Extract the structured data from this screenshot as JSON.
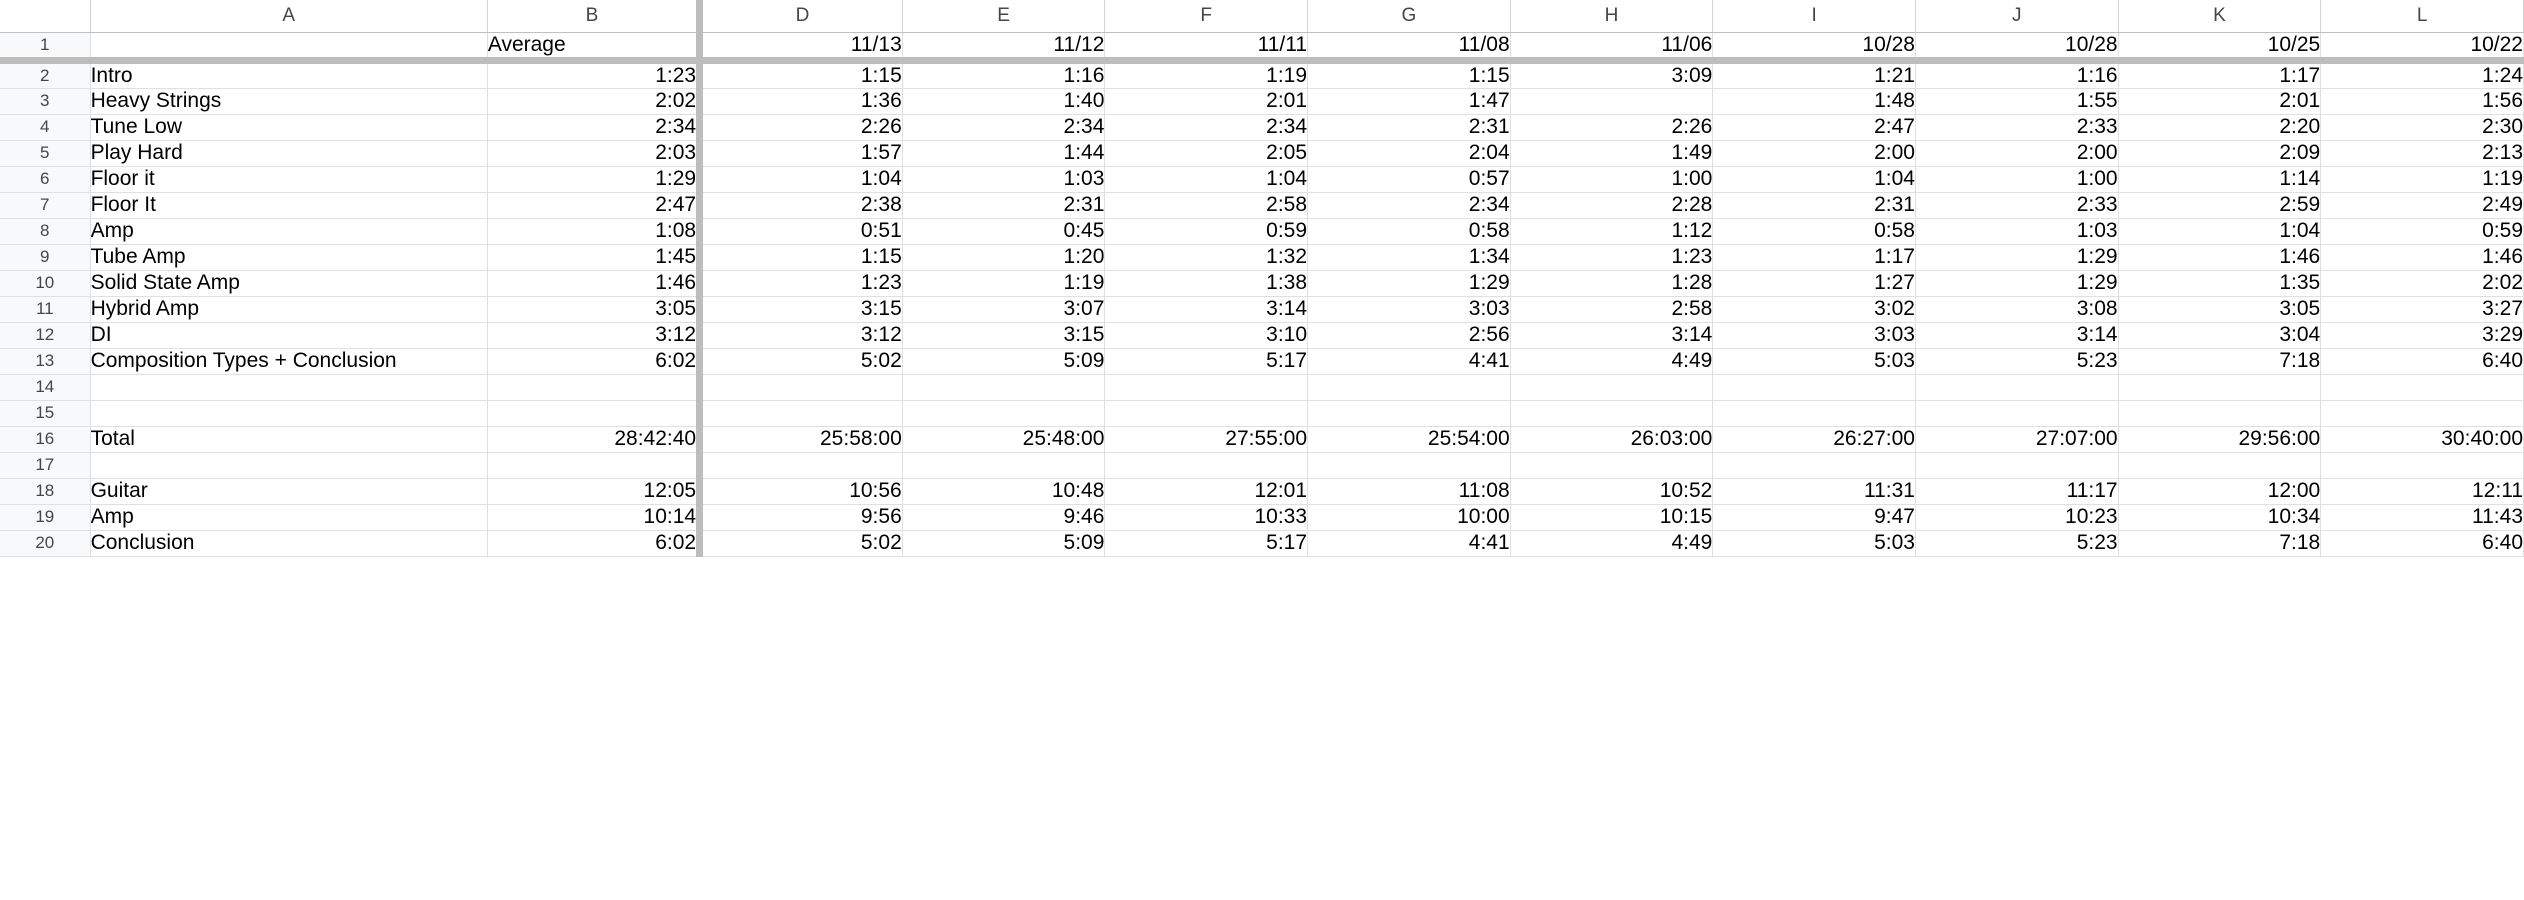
{
  "sheet": {
    "column_letters": [
      "A",
      "B",
      "D",
      "E",
      "F",
      "G",
      "H",
      "I",
      "J",
      "K",
      "L"
    ],
    "hidden_column_note": "C",
    "row_numbers": [
      "1",
      "2",
      "3",
      "4",
      "5",
      "6",
      "7",
      "8",
      "9",
      "10",
      "11",
      "12",
      "13",
      "14",
      "15",
      "16",
      "17",
      "18",
      "19",
      "20"
    ],
    "header_row": {
      "row": "1",
      "a": "",
      "b": "Average",
      "dates": [
        "11/13",
        "11/12",
        "11/11",
        "11/08",
        "11/06",
        "10/28",
        "10/28",
        "10/25",
        "10/22"
      ]
    },
    "rows": [
      {
        "row": "2",
        "label": "Intro",
        "average": "1:23",
        "values": [
          "1:15",
          "1:16",
          "1:19",
          "1:15",
          "3:09",
          "1:21",
          "1:16",
          "1:17",
          "1:24"
        ]
      },
      {
        "row": "3",
        "label": "Heavy Strings",
        "average": "2:02",
        "values": [
          "1:36",
          "1:40",
          "2:01",
          "1:47",
          "",
          "1:48",
          "1:55",
          "2:01",
          "1:56"
        ]
      },
      {
        "row": "4",
        "label": "Tune Low",
        "average": "2:34",
        "values": [
          "2:26",
          "2:34",
          "2:34",
          "2:31",
          "2:26",
          "2:47",
          "2:33",
          "2:20",
          "2:30"
        ]
      },
      {
        "row": "5",
        "label": "Play Hard",
        "average": "2:03",
        "values": [
          "1:57",
          "1:44",
          "2:05",
          "2:04",
          "1:49",
          "2:00",
          "2:00",
          "2:09",
          "2:13"
        ]
      },
      {
        "row": "6",
        "label": "Floor it",
        "average": "1:29",
        "values": [
          "1:04",
          "1:03",
          "1:04",
          "0:57",
          "1:00",
          "1:04",
          "1:00",
          "1:14",
          "1:19"
        ]
      },
      {
        "row": "7",
        "label": "Floor It",
        "average": "2:47",
        "values": [
          "2:38",
          "2:31",
          "2:58",
          "2:34",
          "2:28",
          "2:31",
          "2:33",
          "2:59",
          "2:49"
        ]
      },
      {
        "row": "8",
        "label": "Amp",
        "average": "1:08",
        "values": [
          "0:51",
          "0:45",
          "0:59",
          "0:58",
          "1:12",
          "0:58",
          "1:03",
          "1:04",
          "0:59"
        ]
      },
      {
        "row": "9",
        "label": "Tube Amp",
        "average": "1:45",
        "values": [
          "1:15",
          "1:20",
          "1:32",
          "1:34",
          "1:23",
          "1:17",
          "1:29",
          "1:46",
          "1:46"
        ]
      },
      {
        "row": "10",
        "label": "Solid State Amp",
        "average": "1:46",
        "values": [
          "1:23",
          "1:19",
          "1:38",
          "1:29",
          "1:28",
          "1:27",
          "1:29",
          "1:35",
          "2:02"
        ]
      },
      {
        "row": "11",
        "label": "Hybrid Amp",
        "average": "3:05",
        "values": [
          "3:15",
          "3:07",
          "3:14",
          "3:03",
          "2:58",
          "3:02",
          "3:08",
          "3:05",
          "3:27"
        ]
      },
      {
        "row": "12",
        "label": "DI",
        "average": "3:12",
        "values": [
          "3:12",
          "3:15",
          "3:10",
          "2:56",
          "3:14",
          "3:03",
          "3:14",
          "3:04",
          "3:29"
        ]
      },
      {
        "row": "13",
        "label": "Composition Types + Conclusion",
        "average": "6:02",
        "values": [
          "5:02",
          "5:09",
          "5:17",
          "4:41",
          "4:49",
          "5:03",
          "5:23",
          "7:18",
          "6:40"
        ]
      },
      {
        "row": "14",
        "label": "",
        "average": "",
        "values": [
          "",
          "",
          "",
          "",
          "",
          "",
          "",
          "",
          ""
        ]
      },
      {
        "row": "15",
        "label": "",
        "average": "",
        "values": [
          "",
          "",
          "",
          "",
          "",
          "",
          "",
          "",
          ""
        ]
      },
      {
        "row": "16",
        "label": "Total",
        "average": "28:42:40",
        "values": [
          "25:58:00",
          "25:48:00",
          "27:55:00",
          "25:54:00",
          "26:03:00",
          "26:27:00",
          "27:07:00",
          "29:56:00",
          "30:40:00"
        ]
      },
      {
        "row": "17",
        "label": "",
        "average": "",
        "values": [
          "",
          "",
          "",
          "",
          "",
          "",
          "",
          "",
          ""
        ]
      },
      {
        "row": "18",
        "label": "Guitar",
        "average": "12:05",
        "values": [
          "10:56",
          "10:48",
          "12:01",
          "11:08",
          "10:52",
          "11:31",
          "11:17",
          "12:00",
          "12:11"
        ]
      },
      {
        "row": "19",
        "label": "Amp",
        "average": "10:14",
        "values": [
          "9:56",
          "9:46",
          "10:33",
          "10:00",
          "10:15",
          "9:47",
          "10:23",
          "10:34",
          "11:43"
        ]
      },
      {
        "row": "20",
        "label": "Conclusion",
        "average": "6:02",
        "values": [
          "5:02",
          "5:09",
          "5:17",
          "4:41",
          "4:49",
          "5:03",
          "5:23",
          "7:18",
          "6:40"
        ]
      }
    ]
  },
  "colors": {
    "grid_line": "#e0e0e0",
    "header_background": "#f8f9fa",
    "header_text": "#444746",
    "freeze_divider": "#bdbdbd",
    "cell_text": "#000000"
  }
}
